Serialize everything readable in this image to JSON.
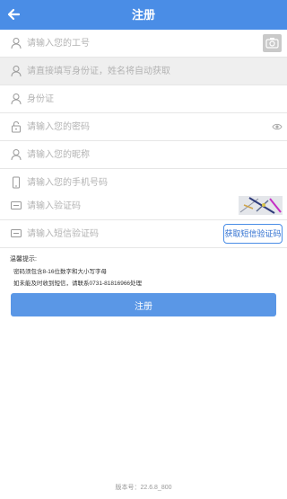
{
  "header": {
    "title": "注册"
  },
  "form": {
    "employee_id_placeholder": "请输入您的工号",
    "name_placeholder": "请直接填写身份证，姓名将自动获取",
    "id_card_placeholder": "身份证",
    "password_placeholder": "请输入您的密码",
    "nickname_placeholder": "请输入您的昵称",
    "phone_placeholder": "请输入您的手机号码",
    "captcha_placeholder": "请输入验证码",
    "sms_placeholder": "请输入短信验证码",
    "sms_button_label": "获取短信验证码"
  },
  "tips": {
    "title": "温馨提示:",
    "line1": "密码须包含8-16位数字和大小写字母",
    "line2": "如未能及时收到短信，请联系0731-81816966处理"
  },
  "submit_label": "注册",
  "version_text": "版本号：22.6.8_800",
  "colors": {
    "header": "#4a8de6",
    "button": "#5a97e6"
  }
}
